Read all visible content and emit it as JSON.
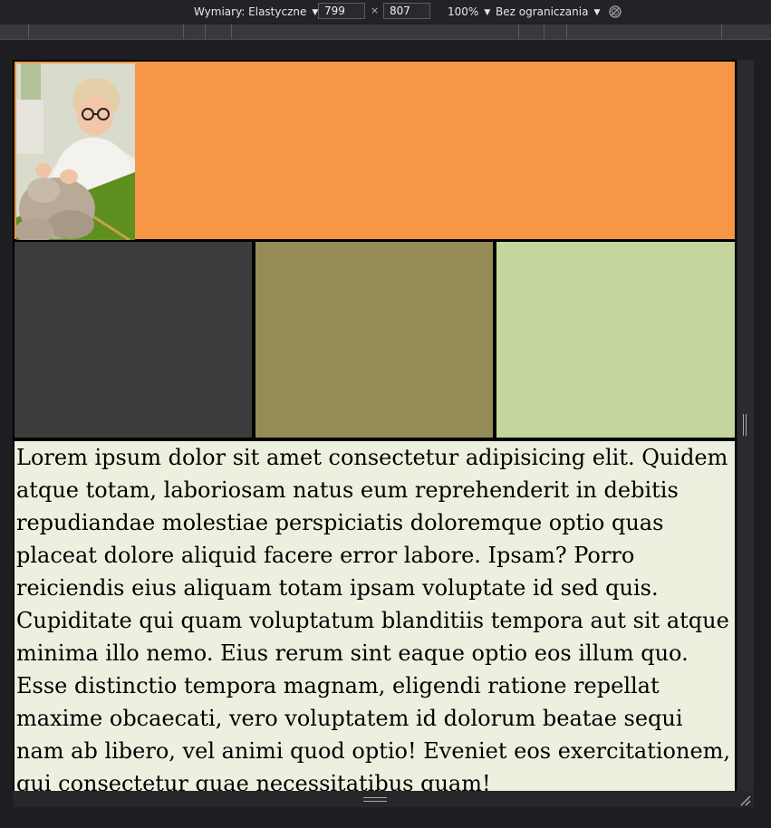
{
  "toolbar": {
    "dimensions_label": "Wymiary: Elastyczne",
    "width_value": "799",
    "height_value": "807",
    "times_symbol": "×",
    "zoom_label": "100%",
    "throttling_label": "Bez ograniczania",
    "rotate_icon": "rotate-disabled-icon"
  },
  "page": {
    "header_color": "#f79646",
    "box_colors": [
      "#3c3c3c",
      "#958b55",
      "#c4d69e"
    ],
    "text_bg": "#ebf1de",
    "paragraph": "Lorem ipsum dolor sit amet consectetur adipisicing elit. Quidem atque totam, laboriosam natus eum reprehenderit in debitis repudiandae molestiae perspiciatis doloremque optio quas placeat dolore aliquid facere error labore. Ipsam? Porro reiciendis eius aliquam totam ipsam voluptate id sed quis. Cupiditate qui quam voluptatum blanditiis tempora aut sit atque minima illo nemo. Eius rerum sint eaque optio eos illum quo. Esse distinctio tempora magnam, eligendi ratione repellat maxime obcaecati, vero voluptatem id dolorum beatae sequi nam ab libero, vel animi quod optio! Eveniet eos exercitationem, qui consectetur quae necessitatibus quam!"
  }
}
